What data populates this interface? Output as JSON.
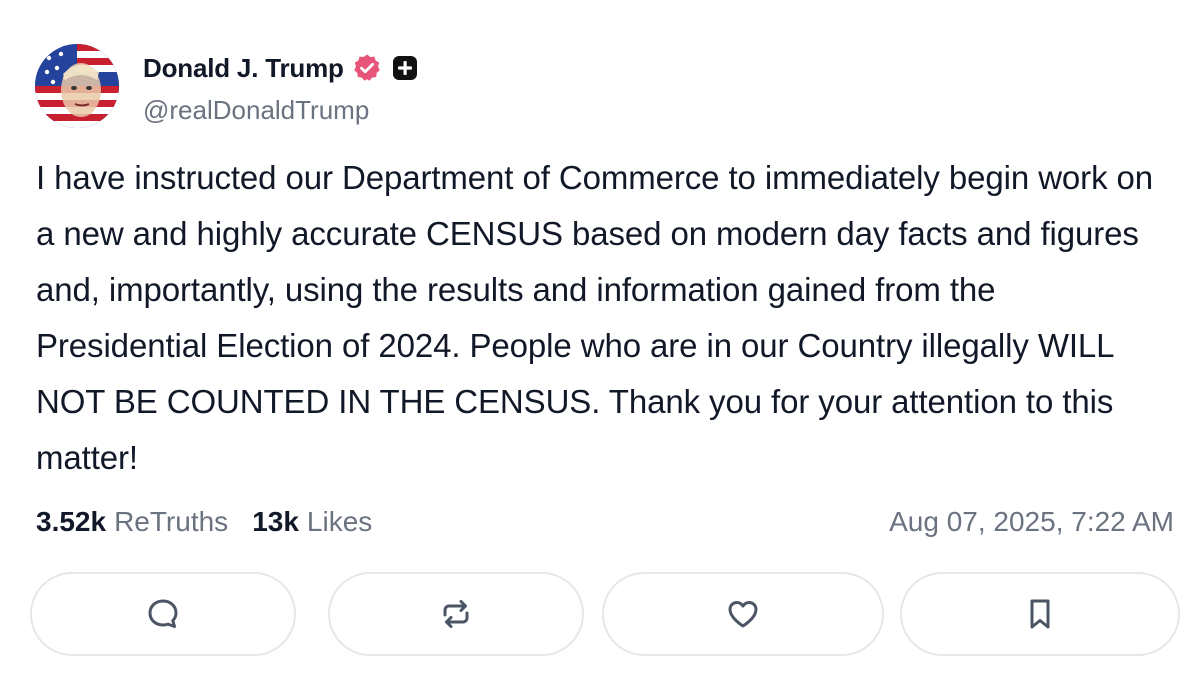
{
  "author": {
    "display_name": "Donald J. Trump",
    "handle": "@realDonaldTrump",
    "avatar_icon": "flag-portrait-avatar",
    "verified_icon": "verified-badge-icon",
    "plus_icon": "truth-plus-badge-icon"
  },
  "post": {
    "text": "I have instructed our Department of Commerce to immediately begin work on a new and highly accurate CENSUS based on modern day facts and figures and, importantly, using the results and information gained from the Presidential Election of 2024. People who are in our Country illegally WILL NOT BE COUNTED IN THE CENSUS. Thank you for your attention to this matter!"
  },
  "stats": {
    "retruths_count": "3.52k",
    "retruths_label": "ReTruths",
    "likes_count": "13k",
    "likes_label": "Likes"
  },
  "timestamp": "Aug 07, 2025, 7:22 AM",
  "actions": {
    "reply_icon": "reply-bubble-icon",
    "retruth_icon": "retruth-arrows-icon",
    "like_icon": "heart-icon",
    "bookmark_icon": "bookmark-icon"
  },
  "colors": {
    "text_primary": "#111827",
    "text_secondary": "#6b7280",
    "verified_pink": "#e8557a",
    "button_border": "#e5e7eb",
    "icon_gray": "#4b5563"
  }
}
